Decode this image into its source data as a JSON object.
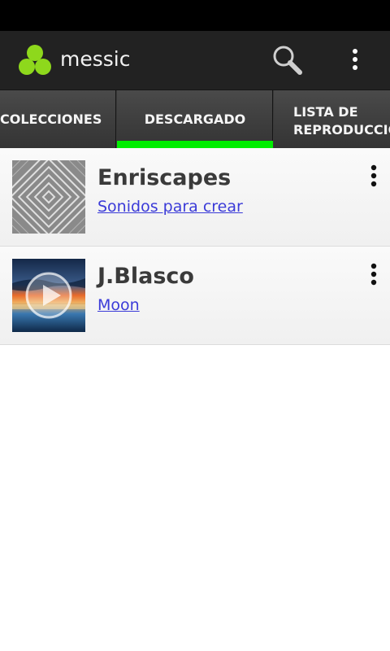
{
  "app": {
    "title": "messic",
    "logo_color": "#8ed81c",
    "icons": {
      "logo": "three-circles-logo-icon",
      "search": "search-icon",
      "overflow": "overflow-menu-icon"
    }
  },
  "tabs": [
    {
      "label": "COLECCIONES",
      "selected": false
    },
    {
      "label": "DESCARGADO",
      "selected": true
    },
    {
      "label": "LISTA DE REPRODUCCIÓN",
      "selected": false
    }
  ],
  "tab_indicator_color": "#00ee00",
  "items": [
    {
      "artist": "Enriscapes",
      "album": "Sonidos para crear",
      "cover_icon": "play-icon"
    },
    {
      "artist": "J.Blasco",
      "album": "Moon",
      "cover_icon": "play-icon"
    }
  ],
  "colors": {
    "action_bar": "#222222",
    "tab_bar": "#3a3a3a",
    "link": "#3b3bd8",
    "artist_text": "#3a3a3a"
  }
}
